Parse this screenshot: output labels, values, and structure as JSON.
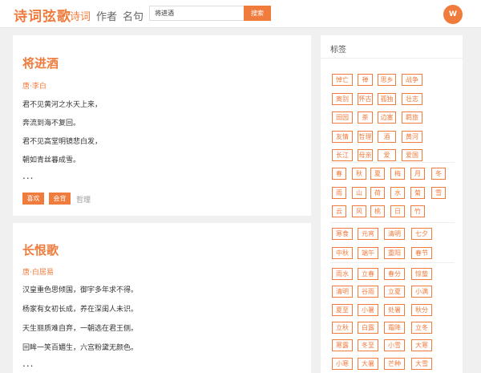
{
  "header": {
    "logo": "诗词弦歌",
    "nav": [
      "诗词",
      "作者",
      "名句"
    ],
    "search_value": "将进酒",
    "search_button": "搜索",
    "avatar": "W"
  },
  "poems": [
    {
      "title": "将进酒",
      "author": "唐·李白",
      "lines": [
        "君不见黄河之水天上来，",
        "奔流到海不复回。",
        "君不见高堂明镜悲白发，",
        "朝如青丝暮成雪。"
      ],
      "ellipsis": "...",
      "tags": [
        "喜欢",
        "会背"
      ],
      "category": "哲理"
    },
    {
      "title": "长恨歌",
      "author": "唐·白居易",
      "lines": [
        "汉皇重色思倾国，御宇多年求不得。",
        "杨家有女初长成，养在深闺人未识。",
        "天生丽质难自弃，一朝选在君王侧。",
        "回眸一笑百媚生，六宫粉黛无颜色。"
      ],
      "ellipsis": "..."
    }
  ],
  "tags_panel": {
    "heading": "标签",
    "groups": [
      [
        "悼亡",
        "禅",
        "思乡",
        "战争",
        "离别",
        "怀古",
        "孤独",
        "壮志",
        "田园",
        "茶",
        "边塞",
        "羁旅",
        "友情",
        "哲理",
        "酒",
        "黄河",
        "长江",
        "母亲",
        "爱",
        "爱国"
      ],
      [
        "春",
        "秋",
        "夏",
        "梅",
        "月",
        "冬",
        "雨",
        "山",
        "荷",
        "水",
        "菊",
        "雪",
        "云",
        "风",
        "桃",
        "日",
        "竹"
      ],
      [
        "寒食",
        "元宵",
        "清明",
        "七夕",
        "中秋",
        "端午",
        "重阳",
        "春节"
      ],
      [
        "雨水",
        "立春",
        "春分",
        "惊蛰",
        "清明",
        "谷雨",
        "立夏",
        "小满",
        "夏至",
        "小暑",
        "处暑",
        "秋分",
        "立秋",
        "白露",
        "霜降",
        "立冬",
        "寒露",
        "冬至",
        "小雪",
        "大寒",
        "小寒",
        "大暑",
        "芒种",
        "大雪"
      ]
    ]
  }
}
